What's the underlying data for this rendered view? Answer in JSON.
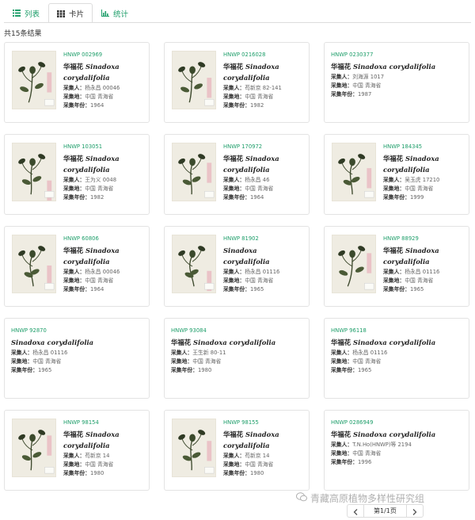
{
  "tabs": [
    {
      "label": "列表",
      "icon": "list-icon"
    },
    {
      "label": "卡片",
      "icon": "grid-icon"
    },
    {
      "label": "统计",
      "icon": "bar-chart-icon"
    }
  ],
  "active_tab": "卡片",
  "result_count_text": "共15条结果",
  "labels": {
    "collector": "采集人：",
    "place": "采集地：",
    "year": "采集年份："
  },
  "cards": [
    {
      "catalog": "HNWP 002969",
      "cn_name": "华福花",
      "sci_name": "Sinadoxa corydalifolia",
      "collector": "杨永昌 00046",
      "place": "中国 青海省",
      "year": "1964",
      "has_image": true
    },
    {
      "catalog": "HNWP 0216028",
      "cn_name": "华福花",
      "sci_name": "Sinadoxa corydalifolia",
      "collector": "苟新京 82-141",
      "place": "中国 青海省",
      "year": "1982",
      "has_image": true
    },
    {
      "catalog": "HNWP 0230377",
      "cn_name": "华福花",
      "sci_name": "Sinadoxa corydalifolia",
      "collector": "刘海源 1017",
      "place": "中国 青海省",
      "year": "1987",
      "has_image": false
    },
    {
      "catalog": "HNWP 103051",
      "cn_name": "华福花",
      "sci_name": "Sinadoxa corydalifolia",
      "collector": "王为义 0048",
      "place": "中国 青海省",
      "year": "1982",
      "has_image": true
    },
    {
      "catalog": "HNWP 170972",
      "cn_name": "华福花",
      "sci_name": "Sinadoxa corydalifolia",
      "collector": "杨永昌 46",
      "place": "中国 青海省",
      "year": "1964",
      "has_image": true
    },
    {
      "catalog": "HNWP 184345",
      "cn_name": "华福花",
      "sci_name": "Sinadoxa corydalifolia",
      "collector": "吴玉虎 17210",
      "place": "中国 青海省",
      "year": "1999",
      "has_image": true
    },
    {
      "catalog": "HNWP 60806",
      "cn_name": "华福花",
      "sci_name": "Sinadoxa corydalifolia",
      "collector": "杨永昌 00046",
      "place": "中国 青海省",
      "year": "1964",
      "has_image": true
    },
    {
      "catalog": "HNWP 81902",
      "cn_name": "",
      "sci_name": "Sinadoxa corydalifolia",
      "collector": "杨永昌 01116",
      "place": "中国 青海省",
      "year": "1965",
      "has_image": true
    },
    {
      "catalog": "HNWP 88929",
      "cn_name": "华福花",
      "sci_name": "Sinadoxa corydalifolia",
      "collector": "杨永昌 01116",
      "place": "中国 青海省",
      "year": "1965",
      "has_image": true
    },
    {
      "catalog": "HNWP 92870",
      "cn_name": "",
      "sci_name": "Sinadoxa corydalifolia",
      "collector": "杨永昌 01116",
      "place": "中国 青海省",
      "year": "1965",
      "has_image": false
    },
    {
      "catalog": "HNWP 93084",
      "cn_name": "华福花",
      "sci_name": "Sinadoxa corydalifolia",
      "collector": "王生新 80-11",
      "place": "中国 青海省",
      "year": "1980",
      "has_image": false
    },
    {
      "catalog": "HNWP 96118",
      "cn_name": "华福花",
      "sci_name": "Sinadoxa corydalifolia",
      "collector": "杨永昌 01116",
      "place": "中国 青海省",
      "year": "1965",
      "has_image": false
    },
    {
      "catalog": "HNWP 98154",
      "cn_name": "华福花",
      "sci_name": "Sinadoxa corydalifolia",
      "collector": "苟新京 14",
      "place": "中国 青海省",
      "year": "1980",
      "has_image": true
    },
    {
      "catalog": "HNWP 98155",
      "cn_name": "华福花",
      "sci_name": "Sinadoxa corydalifolia",
      "collector": "苟新京 14",
      "place": "中国 青海省",
      "year": "1980",
      "has_image": true
    },
    {
      "catalog": "HNWP 0286949",
      "cn_name": "华福花",
      "sci_name": "Sinadoxa corydalifolia",
      "collector": "T.N.Ho(HNWP)等 2194",
      "place": "中国 青海省",
      "year": "1996",
      "has_image": false
    }
  ],
  "pagination": {
    "label": "第1/1页",
    "prev_icon": "chevron-left-icon",
    "next_icon": "chevron-right-icon"
  },
  "watermark": "青藏高原植物多样性研究组",
  "colors": {
    "accent": "#1e9e6a",
    "text": "#333333",
    "border": "#e3e3e3"
  }
}
